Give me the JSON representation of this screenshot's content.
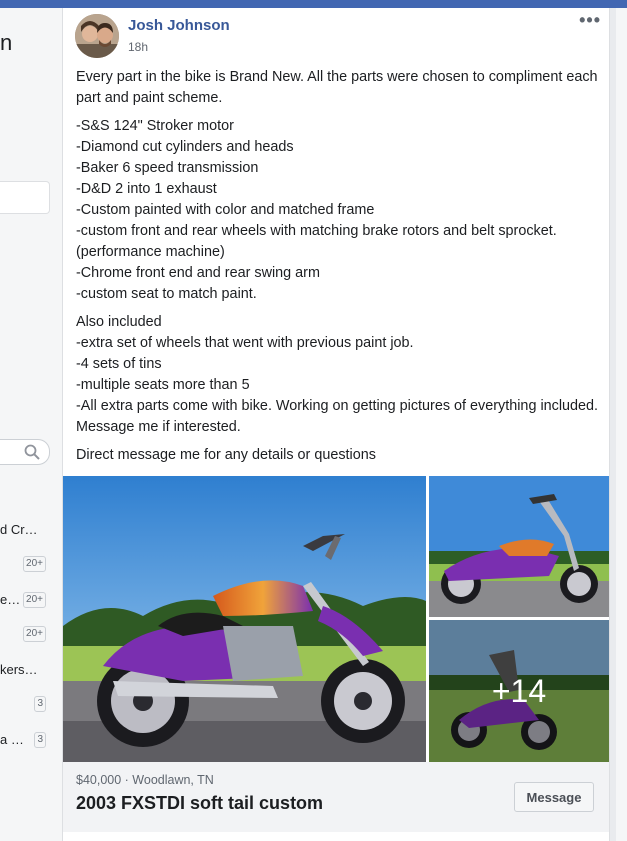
{
  "left_sidebar": {
    "header_fragment": "n",
    "groups": [
      {
        "name": "d Cr…",
        "badge": ""
      },
      {
        "name": "",
        "badge": "20+"
      },
      {
        "name": "e…",
        "badge": "20+"
      },
      {
        "name": "",
        "badge": "20+"
      },
      {
        "name": "kers…",
        "badge": ""
      },
      {
        "name": "",
        "badge": "3"
      },
      {
        "name": "a …",
        "badge": "3"
      }
    ]
  },
  "post": {
    "author": "Josh Johnson",
    "timestamp": "18h",
    "more_label": "•••",
    "paragraph1": "Every part in the bike is Brand New. All the parts were chosen to compliment each part and paint scheme.",
    "specs": [
      "-S&S 124\" Stroker motor",
      "-Diamond cut cylinders and heads",
      "-Baker 6 speed transmission",
      "-D&D 2 into 1 exhaust",
      "-Custom painted with color and matched frame",
      "-custom front and rear wheels with matching brake rotors and belt sprocket. (performance machine)",
      "-Chrome front end and rear swing arm",
      "-custom seat to match paint."
    ],
    "also": [
      "Also included",
      "-extra set of wheels that went with previous paint job.",
      "-4 sets of tins",
      "-multiple seats more than 5",
      "-All extra parts come with bike. Working on getting pictures of everything included. Message me if interested."
    ],
    "closing": "Direct message me for any details or questions",
    "photos": {
      "more_count": "+14"
    },
    "listing": {
      "price_location": "$40,000 · Woodlawn, TN",
      "title": "2003 FXSTDI soft tail custom",
      "message_button": "Message"
    }
  },
  "colors": {
    "accent": "#4267b2",
    "author_link": "#385898",
    "bike_purple": "#7a2fb0"
  }
}
